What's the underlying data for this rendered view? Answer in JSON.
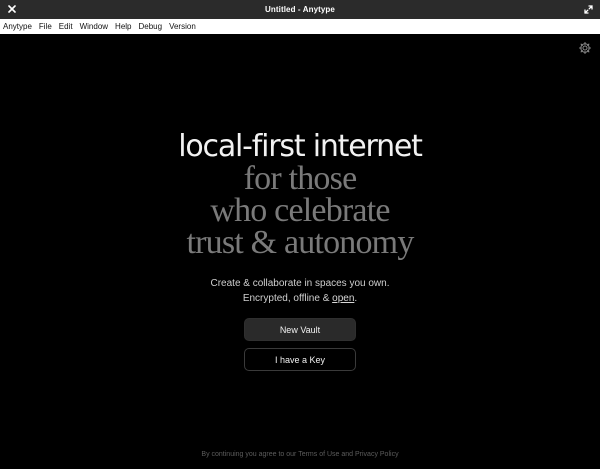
{
  "window": {
    "title": "Untitled - Anytype"
  },
  "menubar": {
    "items": [
      "Anytype",
      "File",
      "Edit",
      "Window",
      "Help",
      "Debug",
      "Version"
    ]
  },
  "hero": {
    "line1": "local-first internet",
    "line2": "for those",
    "line3": "who celebrate",
    "line4": "trust & autonomy"
  },
  "subtitle": {
    "line1": "Create & collaborate in spaces you own.",
    "line2_prefix": "Encrypted, offline & ",
    "line2_link": "open",
    "line2_suffix": "."
  },
  "actions": {
    "new_vault": "New Vault",
    "have_key": "I have a Key"
  },
  "footer": {
    "prefix": "By continuing you agree to our ",
    "terms": "Terms of Use",
    "and": " and ",
    "privacy": "Privacy Policy"
  },
  "colors": {
    "background": "#000000",
    "titlebar": "#2b2b2b",
    "menubar": "#ffffff",
    "headline": "#f2f2f2",
    "headline_muted": "#7a7a7a",
    "primary_button": "#2a2a2a"
  },
  "icons": {
    "close": "close-icon",
    "maximize": "maximize-icon",
    "settings": "gear-icon"
  }
}
